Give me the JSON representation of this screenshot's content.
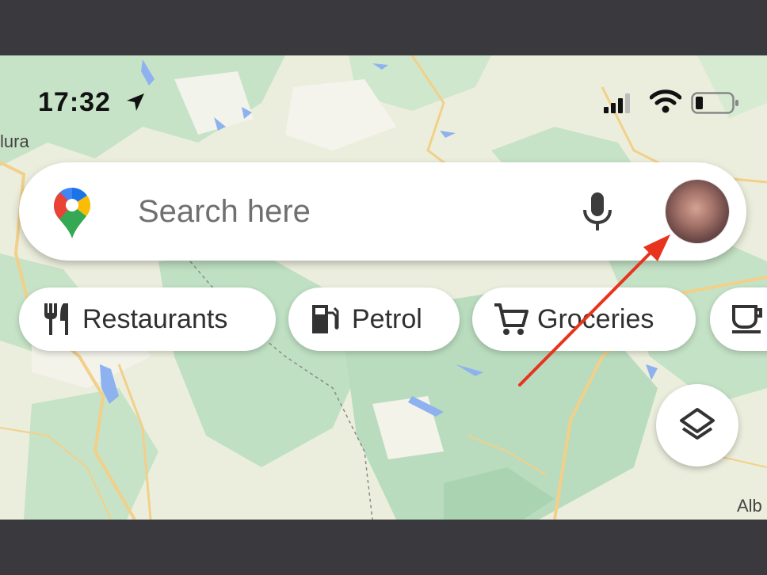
{
  "status_bar": {
    "time": "17:32",
    "location_icon": "location-arrow-icon",
    "signal_icon": "cellular-signal-icon",
    "wifi_icon": "wifi-icon",
    "battery_icon": "battery-low-icon",
    "battery_level": 0.2
  },
  "map": {
    "labels": [
      "lura",
      "Alb"
    ],
    "colors": {
      "land": "#eef0e3",
      "park": "#c4e3c8",
      "water": "#8fb3f0",
      "road": "#f3d38a"
    }
  },
  "search": {
    "placeholder": "Search here",
    "logo_icon": "google-maps-pin-icon",
    "mic_icon": "microphone-icon",
    "avatar_icon": "profile-avatar"
  },
  "chips": [
    {
      "label": "Restaurants",
      "icon": "fork-knife-icon"
    },
    {
      "label": "Petrol",
      "icon": "fuel-pump-icon"
    },
    {
      "label": "Groceries",
      "icon": "shopping-cart-icon"
    },
    {
      "label": "",
      "icon": "coffee-cup-icon"
    }
  ],
  "layers_button": {
    "icon": "layers-icon"
  },
  "annotation": {
    "arrow_color": "#e8331e"
  }
}
